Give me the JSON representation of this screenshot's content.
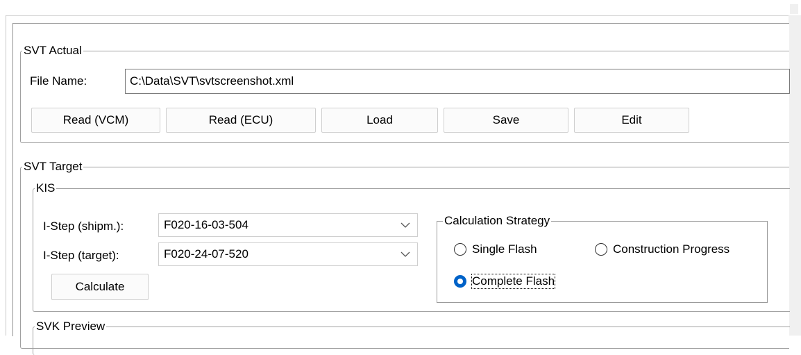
{
  "svt_actual": {
    "legend": "SVT Actual",
    "file_name_label": "File Name:",
    "file_name_value": "C:\\Data\\SVT\\svtscreenshot.xml",
    "buttons": {
      "read_vcm": "Read (VCM)",
      "read_ecu": "Read (ECU)",
      "load": "Load",
      "save": "Save",
      "edit": "Edit"
    }
  },
  "svt_target": {
    "legend": "SVT Target",
    "kis": {
      "legend": "KIS",
      "istep_shipm_label": "I-Step (shipm.):",
      "istep_shipm_value": "F020-16-03-504",
      "istep_target_label": "I-Step (target):",
      "istep_target_value": "F020-24-07-520",
      "calculate_label": "Calculate",
      "strategy": {
        "legend": "Calculation Strategy",
        "options": {
          "single_flash": "Single Flash",
          "construction_progress": "Construction Progress",
          "complete_flash": "Complete Flash"
        },
        "selected": "Complete Flash"
      }
    },
    "svk_preview": {
      "legend": "SVK Preview"
    }
  },
  "colors": {
    "accent": "#0062c8",
    "group_border": "#a0a0a0"
  }
}
